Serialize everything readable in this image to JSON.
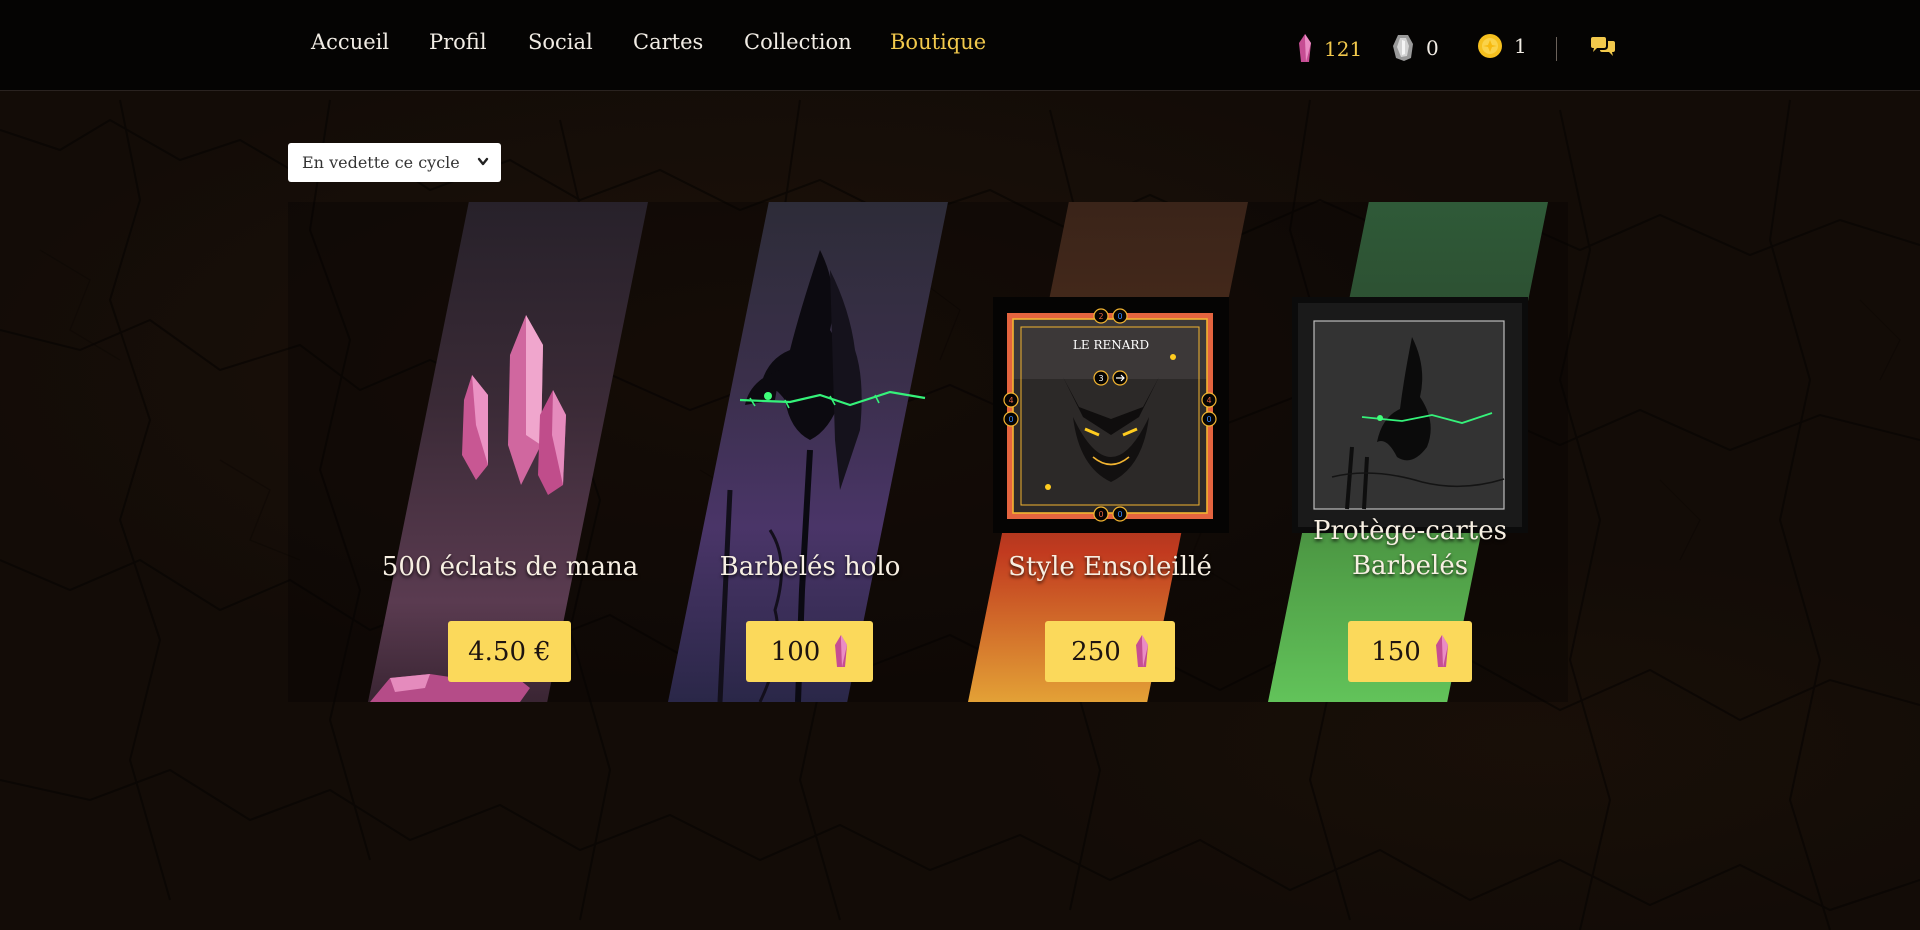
{
  "nav": {
    "links": [
      "Accueil",
      "Profil",
      "Social",
      "Cartes",
      "Collection",
      "Boutique"
    ],
    "active": "Boutique"
  },
  "resources": {
    "mana": "121",
    "shards": "0",
    "coins": "1"
  },
  "filter": {
    "selected": "En vedette ce cycle"
  },
  "items": [
    {
      "title": "500 éclats de mana",
      "price": "4.50 €",
      "currency_icon": ""
    },
    {
      "title": "Barbelés holo",
      "price": "100",
      "currency_icon": "mana-crystal-icon"
    },
    {
      "title": "Style Ensoleillé",
      "price": "250",
      "currency_icon": "mana-crystal-icon",
      "card_name": "LE RENARD",
      "card_stats": [
        "2",
        "0",
        "3",
        "4",
        "0",
        "4",
        "0",
        "0",
        "0"
      ]
    },
    {
      "title": "Protège-cartes Barbelés",
      "price": "150",
      "currency_icon": "mana-crystal-icon"
    }
  ],
  "colors": {
    "accent": "#f2c94c",
    "button": "#fbd95b",
    "mana": "#e07ab6"
  }
}
